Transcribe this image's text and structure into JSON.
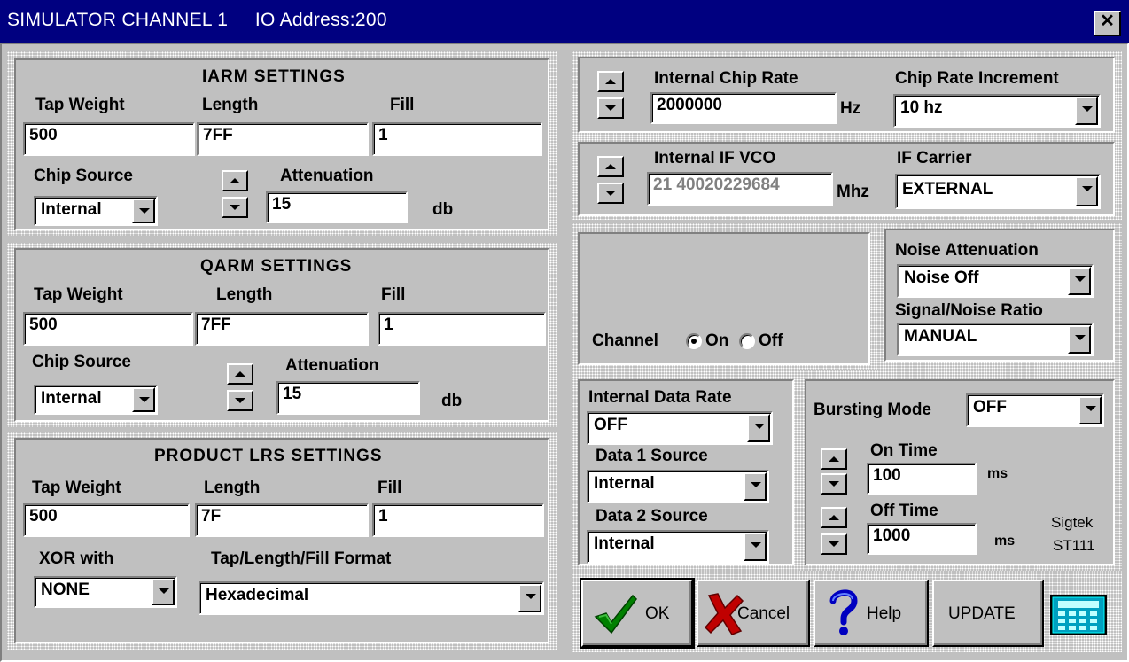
{
  "window": {
    "title": "SIMULATOR CHANNEL 1     IO Address:200",
    "close_label": "✕"
  },
  "iarm": {
    "heading": "IARM SETTINGS",
    "tap_weight_label": "Tap Weight",
    "length_label": "Length",
    "fill_label": "Fill",
    "tap_weight": "500",
    "length": "7FF",
    "fill": "1",
    "chip_source_label": "Chip Source",
    "chip_source": "Internal",
    "attenuation_label": "Attenuation",
    "attenuation": "15",
    "unit": "db"
  },
  "qarm": {
    "heading": "QARM SETTINGS",
    "tap_weight_label": "Tap Weight",
    "length_label": "Length",
    "fill_label": "Fill",
    "tap_weight": "500",
    "length": "7FF",
    "fill": "1",
    "chip_source_label": "Chip Source",
    "chip_source": "Internal",
    "attenuation_label": "Attenuation",
    "attenuation": "15",
    "unit": "db"
  },
  "lrs": {
    "heading": "PRODUCT LRS SETTINGS",
    "tap_weight_label": "Tap Weight",
    "length_label": "Length",
    "fill_label": "Fill",
    "tap_weight": "500",
    "length": "7F",
    "fill": "1",
    "xor_label": "XOR with",
    "xor_value": "NONE",
    "format_label": "Tap/Length/Fill Format",
    "format_value": "Hexadecimal"
  },
  "chip_rate": {
    "label": "Internal Chip Rate",
    "value": "2000000",
    "unit": "Hz",
    "increment_label": "Chip Rate Increment",
    "increment_value": "10 hz"
  },
  "if_vco": {
    "label": "Internal  IF VCO",
    "value": "21 40020229684",
    "unit": "Mhz",
    "carrier_label": "IF Carrier",
    "carrier_value": "EXTERNAL"
  },
  "channel": {
    "label": "Channel",
    "on_label": "On",
    "off_label": "Off",
    "selected": "On"
  },
  "noise": {
    "attenuation_label": "Noise Attenuation",
    "attenuation_value": "Noise Off",
    "snr_label": "Signal/Noise Ratio",
    "snr_value": "MANUAL"
  },
  "data": {
    "rate_label": "Internal Data Rate",
    "rate_value": "OFF",
    "source1_label": "Data 1 Source",
    "source1_value": "Internal",
    "source2_label": "Data 2 Source",
    "source2_value": "Internal"
  },
  "bursting": {
    "mode_label": "Bursting Mode",
    "mode_value": "OFF",
    "on_time_label": "On Time",
    "on_time": "100",
    "off_time_label": "Off Time",
    "off_time": "1000",
    "unit": "ms",
    "brand_line1": "Sigtek",
    "brand_line2": "ST111"
  },
  "buttons": {
    "ok": "OK",
    "cancel": "Cancel",
    "help": "Help",
    "update": "UPDATE"
  },
  "icons": {
    "ok": "checkmark-icon",
    "cancel": "x-icon",
    "help": "question-icon",
    "keypad": "keypad-icon"
  },
  "colors": {
    "titlebar": "#000080",
    "face": "#c0c0c0",
    "ok_check": "#008000",
    "cancel_x": "#c00000",
    "help_q": "#0000c0",
    "keypad": "#00a0c0"
  }
}
